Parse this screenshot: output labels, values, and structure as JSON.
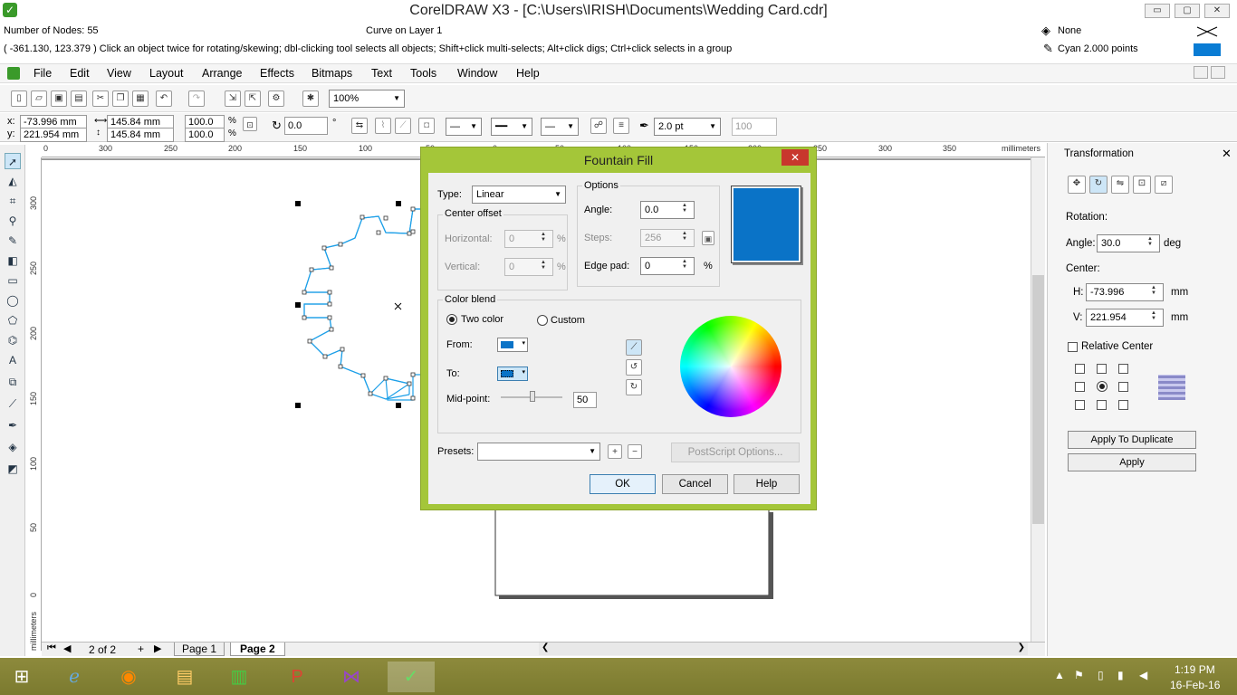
{
  "window": {
    "title": "CorelDRAW X3 - [C:\\Users\\IRISH\\Documents\\Wedding Card.cdr]",
    "min": "▭",
    "restore": "▢",
    "close": "✕"
  },
  "status": {
    "nodes": "Number of Nodes: 55",
    "layer": "Curve on Layer 1",
    "hint": "( -361.130, 123.379 )   Click an object twice for rotating/skewing; dbl-clicking tool selects all objects; Shift+click multi-selects; Alt+click digs; Ctrl+click selects in a group",
    "fill": "None",
    "outline": "Cyan  2.000 points"
  },
  "menu": [
    "File",
    "Edit",
    "View",
    "Layout",
    "Arrange",
    "Effects",
    "Bitmaps",
    "Text",
    "Tools",
    "Window",
    "Help"
  ],
  "toolbar": {
    "zoom": "100%"
  },
  "property_bar": {
    "x": "-73.996 mm",
    "y": "221.954 mm",
    "w": "145.84 mm",
    "h": "145.84 mm",
    "sx": "100.0",
    "sy": "100.0",
    "pct1": "%",
    "pct2": "%",
    "rotation": "0.0",
    "deg": "°",
    "outline_width": "2.0 pt",
    "hundred": "100"
  },
  "ruler_top": [
    "0",
    "300",
    "250",
    "200",
    "150",
    "100",
    "50",
    "0",
    "50",
    "100",
    "150",
    "200",
    "250",
    "300",
    "350",
    "millimeters"
  ],
  "ruler_left": [
    "300",
    "250",
    "200",
    "150",
    "100",
    "50",
    "0",
    "millimeters"
  ],
  "pages": {
    "count": "2 of 2",
    "page1": "Page 1",
    "page2": "Page 2"
  },
  "dock": {
    "title": "Transformation",
    "rotation_label": "Rotation:",
    "angle_label": "Angle:",
    "angle": "30.0",
    "deg": "deg",
    "center_label": "Center:",
    "h_label": "H:",
    "h": "-73.996",
    "v_label": "V:",
    "v": "221.954",
    "mm": "mm",
    "relative_center": "Relative Center",
    "apply_duplicate": "Apply To Duplicate",
    "apply": "Apply"
  },
  "dialog": {
    "title": "Fountain Fill",
    "close": "✕",
    "type_label": "Type:",
    "type_value": "Linear",
    "center_offset": "Center offset",
    "horizontal_label": "Horizontal:",
    "horizontal": "0",
    "vertical_label": "Vertical:",
    "vertical": "0",
    "pct": "%",
    "options": "Options",
    "angle_label": "Angle:",
    "angle": "0.0",
    "steps_label": "Steps:",
    "steps": "256",
    "edge_pad_label": "Edge pad:",
    "edge_pad": "0",
    "color_blend": "Color blend",
    "two_color": "Two color",
    "custom": "Custom",
    "from": "From:",
    "to": "To:",
    "midpoint_label": "Mid-point:",
    "midpoint": "50",
    "presets_label": "Presets:",
    "postscript": "PostScript Options...",
    "ok": "OK",
    "cancel": "Cancel",
    "help": "Help",
    "preview_color": "#0a73c7"
  },
  "taskbar": {
    "time": "1:19 PM",
    "date": "16-Feb-16"
  }
}
